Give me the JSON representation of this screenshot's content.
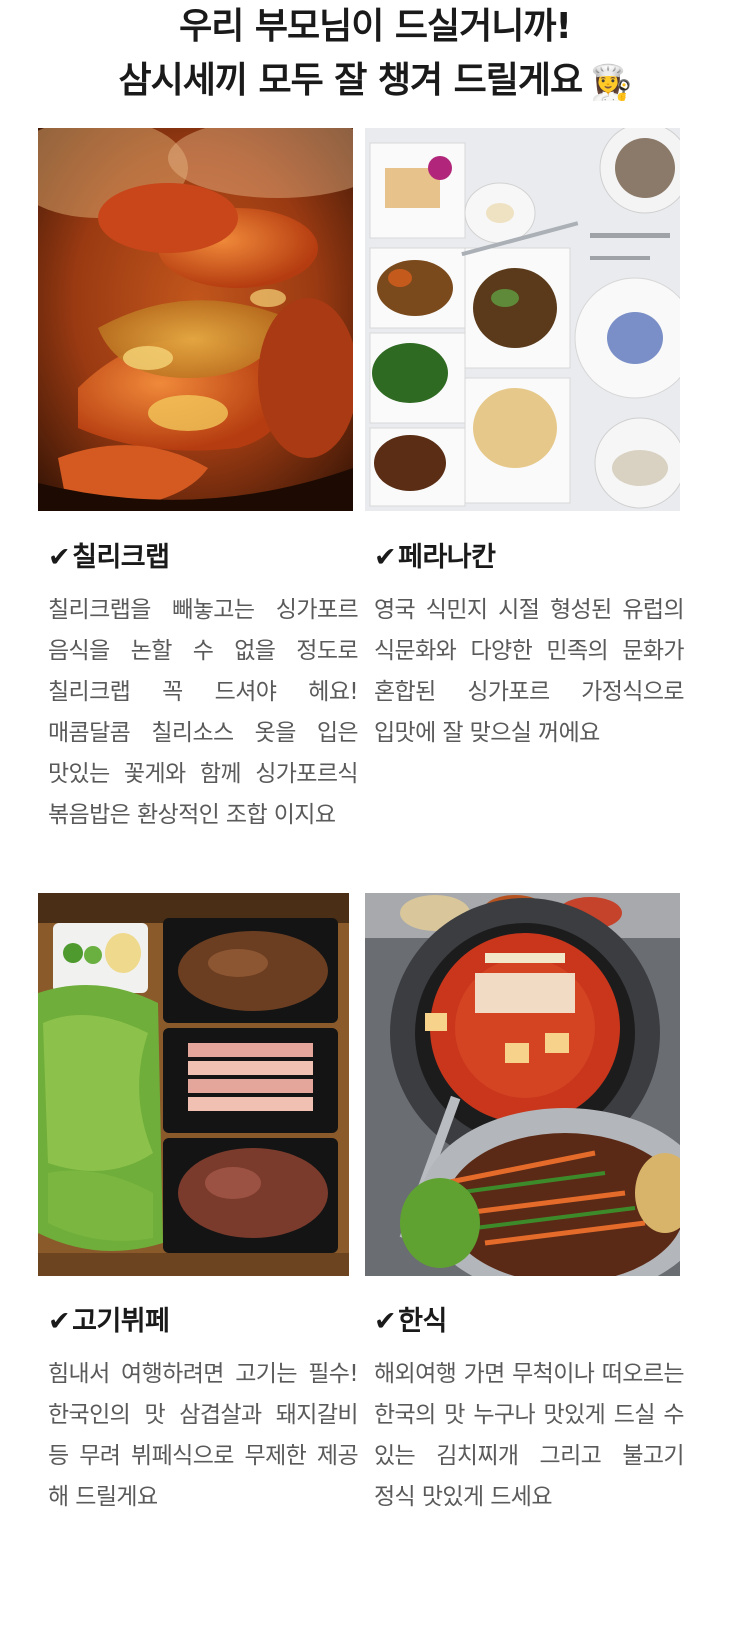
{
  "header": {
    "line1": "우리 부모님이 드실거니까!",
    "line2": "삼시세끼 모두 잘 챙겨 드릴게요",
    "emoji": "👩‍🍳",
    "emoji_icon": "chef-emoji-icon"
  },
  "check_mark": "✔",
  "items": [
    {
      "title": "칠리크랩",
      "description": "칠리크랩을 빼놓고는 싱가포르 음식을 논할 수 없을 정도로 칠리크랩 꼭 드셔야 헤요! 매콤달콤 칠리소스 옷을 입은 맛있는 꽃게와 함께 싱가포르식 볶음밥은 환상적인 조합 이지요"
    },
    {
      "title": "페라나칸",
      "description": "영국 식민지 시절 형성된 유럽의 식문화와 다양한 민족의 문화가 혼합된 싱가포르 가정식으로 입맛에 잘 맞으실 꺼에요"
    },
    {
      "title": "고기뷔페",
      "description": "힘내서 여행하려면 고기는 필수! 한국인의 맛 삼겹살과 돼지갈비 등 무려 뷔페식으로 무제한 제공 해 드릴게요"
    },
    {
      "title": "한식",
      "description": "해외여행 가면 무척이나 떠오르는 한국의 맛 누구나 맛있게 드실 수 있는 김치찌개 그리고 불고기 정식 맛있게 드세요"
    }
  ],
  "colors": {
    "text": "#1a1a1a",
    "muted": "#5a5a5a",
    "background": "#ffffff"
  }
}
